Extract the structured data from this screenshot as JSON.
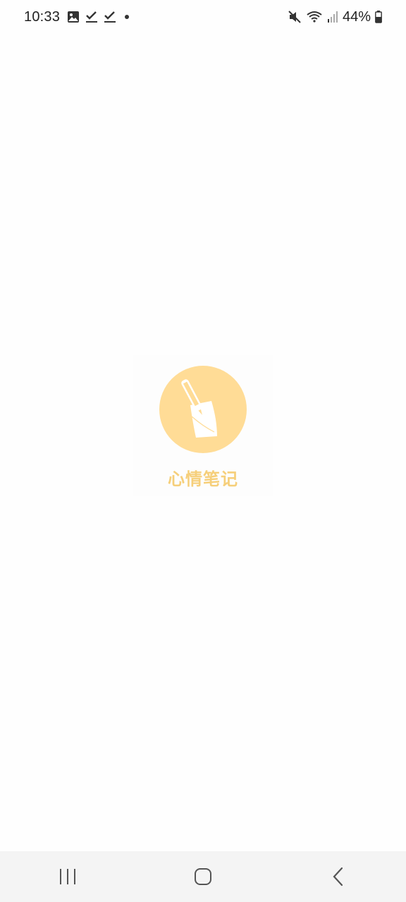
{
  "status_bar": {
    "time": "10:33",
    "battery": "44%",
    "left_icons": [
      "image-icon",
      "check-icon",
      "check-icon",
      "dot-icon"
    ],
    "right_icons": [
      "mute-icon",
      "wifi-icon",
      "signal-icon",
      "battery-icon"
    ]
  },
  "splash": {
    "app_name": "心情笔记",
    "logo_icon": "pen-paper-icon",
    "logo_color": "#ffdc96",
    "text_color": "#f6cf7a"
  },
  "nav_bar": {
    "buttons": [
      "recent-apps",
      "home",
      "back"
    ]
  }
}
